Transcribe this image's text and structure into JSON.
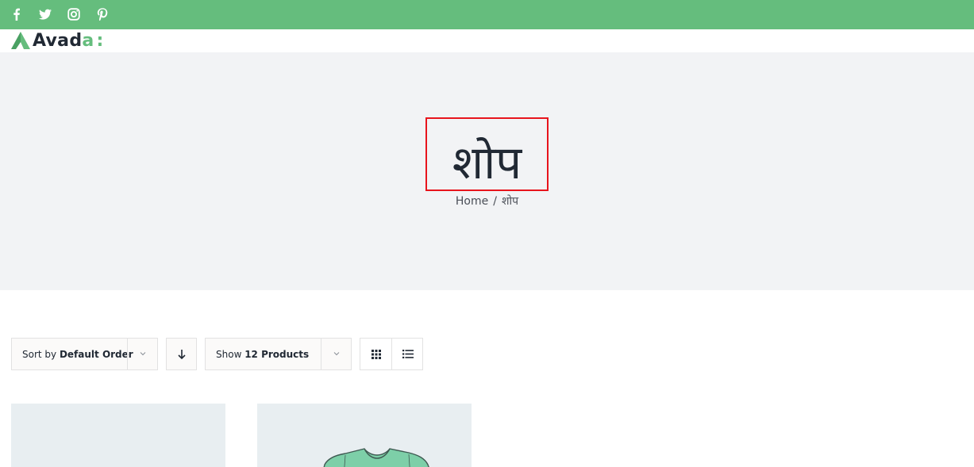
{
  "topbar": {
    "background": "#65bd7d",
    "social": [
      "facebook-icon",
      "twitter-icon",
      "instagram-icon",
      "pinterest-icon"
    ]
  },
  "logo": {
    "text_main": "Avad",
    "text_accent": "a",
    "text_dots": ":",
    "accent_color": "#65bd7d"
  },
  "page_title": {
    "title": "शोप",
    "highlight_color": "#e8141c"
  },
  "breadcrumb": {
    "home": "Home",
    "separator": "/",
    "current": "शोप"
  },
  "toolbar": {
    "sort_prefix": "Sort by ",
    "sort_value": "Default Order",
    "order_icon": "arrow-down-icon",
    "show_prefix": "Show ",
    "show_value": "12 Products",
    "views": [
      "grid-view-icon",
      "list-view-icon"
    ]
  },
  "products": [
    {
      "image": "placeholder"
    },
    {
      "image": "tshirt"
    }
  ],
  "colors": {
    "title_bar_bg": "#f2f3f5",
    "text": "#212934",
    "product_bg": "#e8eef1"
  }
}
